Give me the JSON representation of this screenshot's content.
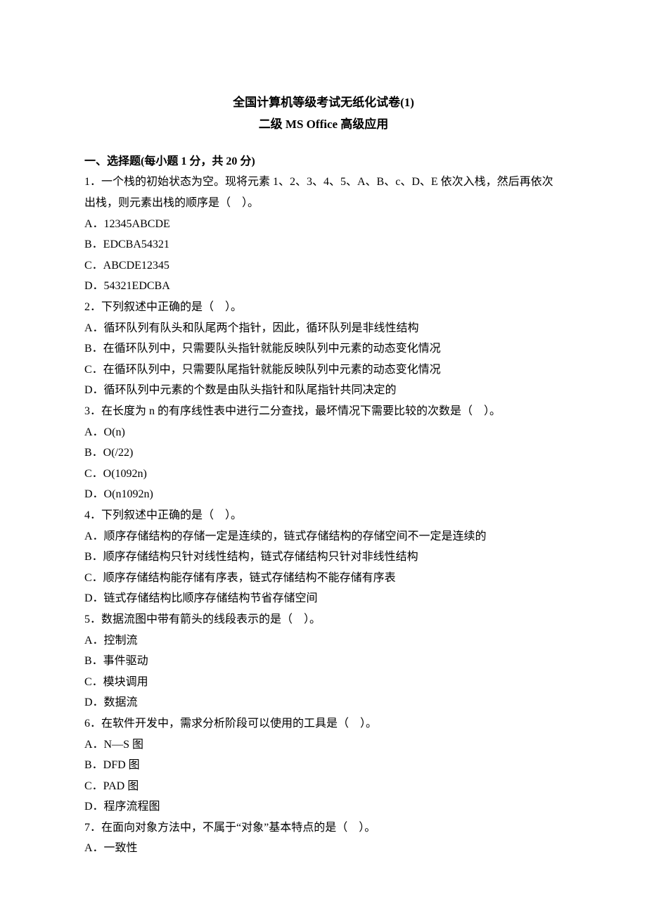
{
  "title": "全国计算机等级考试无纸化试卷(1)",
  "subtitle": "二级 MS Office 高级应用",
  "section_heading": "一、选择题(每小题 1 分，共 20 分)",
  "questions": [
    {
      "stem": "1．一个栈的初始状态为空。现将元素 1、2、3、4、5、A、B、c、D、E 依次入栈，然后再依次出栈，则元素出栈的顺序是（    ）。",
      "options": [
        "A．12345ABCDE",
        "B．EDCBA54321",
        "C．ABCDE12345",
        "D．54321EDCBA"
      ]
    },
    {
      "stem": "2．下列叙述中正确的是（    ）。",
      "options": [
        "A．循环队列有队头和队尾两个指针，因此，循环队列是非线性结构",
        "B．在循环队列中，只需要队头指针就能反映队列中元素的动态变化情况",
        "C．在循环队列中，只需要队尾指针就能反映队列中元素的动态变化情况",
        "D．循环队列中元素的个数是由队头指针和队尾指针共同决定的"
      ]
    },
    {
      "stem": "3．在长度为 n 的有序线性表中进行二分查找，最坏情况下需要比较的次数是（    ）。",
      "options": [
        "A．O(n)",
        "B．O(/22)",
        "C．O(1092n)",
        "D．O(n1092n)"
      ]
    },
    {
      "stem": "4．下列叙述中正确的是（    ）。",
      "options": [
        "A．顺序存储结构的存储一定是连续的，链式存储结构的存储空间不一定是连续的",
        "B．顺序存储结构只针对线性结构，链式存储结构只针对非线性结构",
        "C．顺序存储结构能存储有序表，链式存储结构不能存储有序表",
        "D．链式存储结构比顺序存储结构节省存储空间"
      ]
    },
    {
      "stem": "5．数据流图中带有箭头的线段表示的是（    ）。",
      "options": [
        "A．控制流",
        "B．事件驱动",
        "C．模块调用",
        "D．数据流"
      ]
    },
    {
      "stem": "6．在软件开发中，需求分析阶段可以使用的工具是（    ）。",
      "options": [
        "A．N—S 图",
        "B．DFD 图",
        "C．PAD 图",
        "D．程序流程图"
      ]
    },
    {
      "stem": "7．在面向对象方法中，不属于“对象”基本特点的是（    ）。",
      "options": [
        "A．一致性"
      ]
    }
  ]
}
